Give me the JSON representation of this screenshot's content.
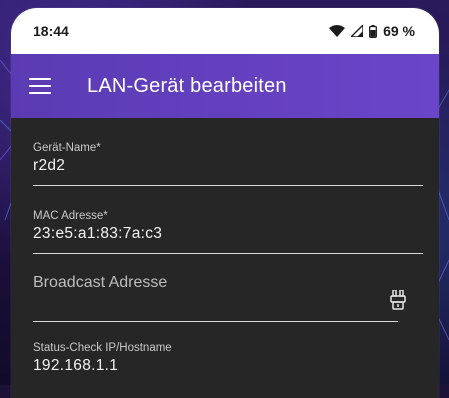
{
  "status_bar": {
    "time": "18:44",
    "battery": "69 %",
    "icons": [
      "wifi-icon",
      "cell-signal-icon",
      "battery-icon"
    ]
  },
  "app_bar": {
    "title": "LAN-Gerät bearbeiten",
    "menu_icon": "menu-icon",
    "color": "#5e3db8"
  },
  "form": {
    "device_name": {
      "label": "Gerät-Name*",
      "value": "r2d2"
    },
    "mac_address": {
      "label": "MAC Adresse*",
      "value": "23:e5:a1:83:7a:c3"
    },
    "broadcast": {
      "placeholder": "Broadcast Adresse",
      "icon": "broadcast-picker-icon"
    },
    "status_check": {
      "label": "Status-Check IP/Hostname",
      "value": "192.168.1.1"
    }
  }
}
